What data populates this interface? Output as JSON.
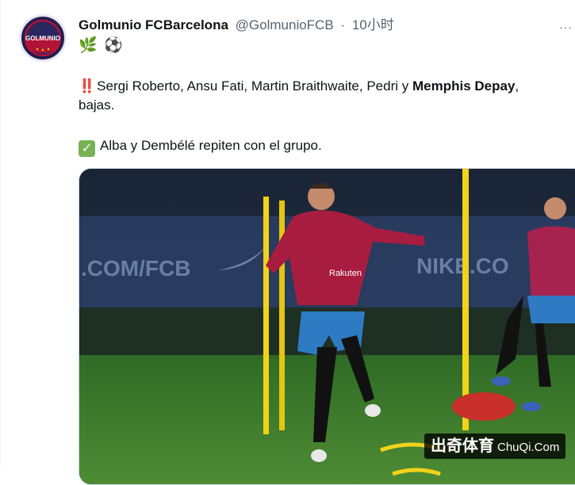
{
  "tweet": {
    "display_name": "Golmunio FCBarcelona",
    "handle": "@GolmunioFCB",
    "separator": "·",
    "time": "10小时",
    "more_icon": "···",
    "bio_emoji": [
      "🌿",
      "⚽"
    ],
    "avatar_text": "GOLMUNIO",
    "line1_emoji": "‼️",
    "line1_plain": "Sergi Roberto, Ansu Fati, Martin Braithwaite, Pedri y ",
    "line1_bold": "Memphis Depay",
    "line1_end": ",",
    "line2": "bajas.",
    "line3_emoji": "✓",
    "line3": "Alba y Dembélé repiten con el grupo."
  },
  "media": {
    "board_text_left": ".COM/FCB",
    "board_text_right": "NIKE.CO",
    "shirt_text": "Rakuten",
    "colors": {
      "jersey": "#a81d3f",
      "shorts": "#2e7bc4",
      "pole": "#f2d21b",
      "grass": "#3f7c2e"
    }
  },
  "watermark": {
    "brand": "出奇体育",
    "site": "ChuQi.Com"
  }
}
